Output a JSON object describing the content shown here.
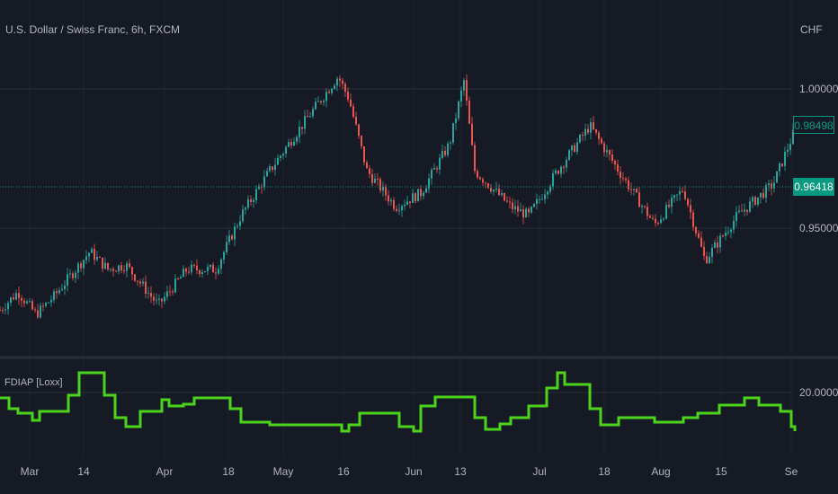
{
  "header": {
    "symbol_title": "U.S. Dollar / Swiss Franc, 6h, FXCM",
    "currency": "CHF"
  },
  "price_axis": {
    "labels": [
      "1.00000",
      "0.95000"
    ],
    "last_high_tag": "0.98498",
    "current_price_tag": "0.96418"
  },
  "indicator": {
    "name": "FDIAP [Loxx]",
    "axis_label": "20.00000"
  },
  "time_axis": {
    "labels": [
      "Mar",
      "14",
      "Apr",
      "18",
      "May",
      "16",
      "Jun",
      "13",
      "Jul",
      "18",
      "Aug",
      "15",
      "Se"
    ]
  },
  "colors": {
    "background": "#161a25",
    "up": "#26a69a",
    "down": "#ef5350",
    "indicator": "#4cd41c",
    "current_price": "#089981"
  },
  "chart_data": [
    {
      "type": "candlestick",
      "title": "U.S. Dollar / Swiss Franc, 6h, FXCM",
      "ylim": [
        0.905,
        1.015
      ],
      "x_unit": "bar index",
      "price_path": [
        [
          0,
          0.9206
        ],
        [
          5,
          0.9271
        ],
        [
          10,
          0.919
        ],
        [
          15,
          0.9255
        ],
        [
          25,
          0.9416
        ],
        [
          30,
          0.9352
        ],
        [
          35,
          0.9368
        ],
        [
          44,
          0.9223
        ],
        [
          52,
          0.9352
        ],
        [
          60,
          0.9352
        ],
        [
          67,
          0.9545
        ],
        [
          75,
          0.9706
        ],
        [
          82,
          0.9835
        ],
        [
          94,
          1.0045
        ],
        [
          97,
          0.9965
        ],
        [
          102,
          0.9706
        ],
        [
          110,
          0.9577
        ],
        [
          117,
          0.9626
        ],
        [
          125,
          0.9803
        ],
        [
          129,
          1.0029
        ],
        [
          132,
          0.9706
        ],
        [
          142,
          0.9577
        ],
        [
          147,
          0.9545
        ],
        [
          155,
          0.9706
        ],
        [
          164,
          0.9868
        ],
        [
          172,
          0.9706
        ],
        [
          182,
          0.9513
        ],
        [
          190,
          0.9642
        ],
        [
          196,
          0.9384
        ],
        [
          205,
          0.9545
        ],
        [
          215,
          0.9658
        ],
        [
          221,
          0.9852
        ]
      ],
      "current_price": 0.96418,
      "high_marker": 0.98498
    },
    {
      "type": "line",
      "title": "FDIAP [Loxx]",
      "x_unit": "bar index",
      "reference_level": 20.0,
      "points": [
        [
          0,
          19.4
        ],
        [
          2.5,
          18.2
        ],
        [
          5,
          17.7
        ],
        [
          9,
          16.9
        ],
        [
          11,
          17.9
        ],
        [
          15,
          17.9
        ],
        [
          19,
          19.7
        ],
        [
          22,
          22.2
        ],
        [
          26,
          22.2
        ],
        [
          29,
          19.7
        ],
        [
          32,
          17.2
        ],
        [
          35,
          16.2
        ],
        [
          39,
          17.9
        ],
        [
          42,
          17.9
        ],
        [
          45,
          19.2
        ],
        [
          47,
          18.5
        ],
        [
          51,
          18.7
        ],
        [
          54,
          19.4
        ],
        [
          60,
          19.4
        ],
        [
          64,
          18.2
        ],
        [
          67,
          16.7
        ],
        [
          75,
          16.4
        ],
        [
          81,
          16.4
        ],
        [
          95,
          15.7
        ],
        [
          97,
          16.4
        ],
        [
          100,
          17.7
        ],
        [
          107,
          17.7
        ],
        [
          111,
          16.2
        ],
        [
          115,
          15.7
        ],
        [
          117,
          18.5
        ],
        [
          121,
          19.5
        ],
        [
          129,
          19.5
        ],
        [
          132,
          17.2
        ],
        [
          135,
          15.9
        ],
        [
          139,
          16.5
        ],
        [
          142,
          17.2
        ],
        [
          147,
          18.5
        ],
        [
          152,
          20.5
        ],
        [
          155,
          22.2
        ],
        [
          157,
          20.9
        ],
        [
          161,
          20.9
        ],
        [
          164,
          18.2
        ],
        [
          167,
          16.4
        ],
        [
          172,
          17.2
        ],
        [
          177,
          17.2
        ],
        [
          182,
          16.7
        ],
        [
          190,
          17.2
        ],
        [
          194,
          17.7
        ],
        [
          200,
          18.6
        ],
        [
          204,
          18.6
        ],
        [
          207,
          19.4
        ],
        [
          211,
          18.6
        ],
        [
          217,
          17.9
        ],
        [
          220,
          16.2
        ],
        [
          221,
          15.7
        ]
      ]
    }
  ]
}
